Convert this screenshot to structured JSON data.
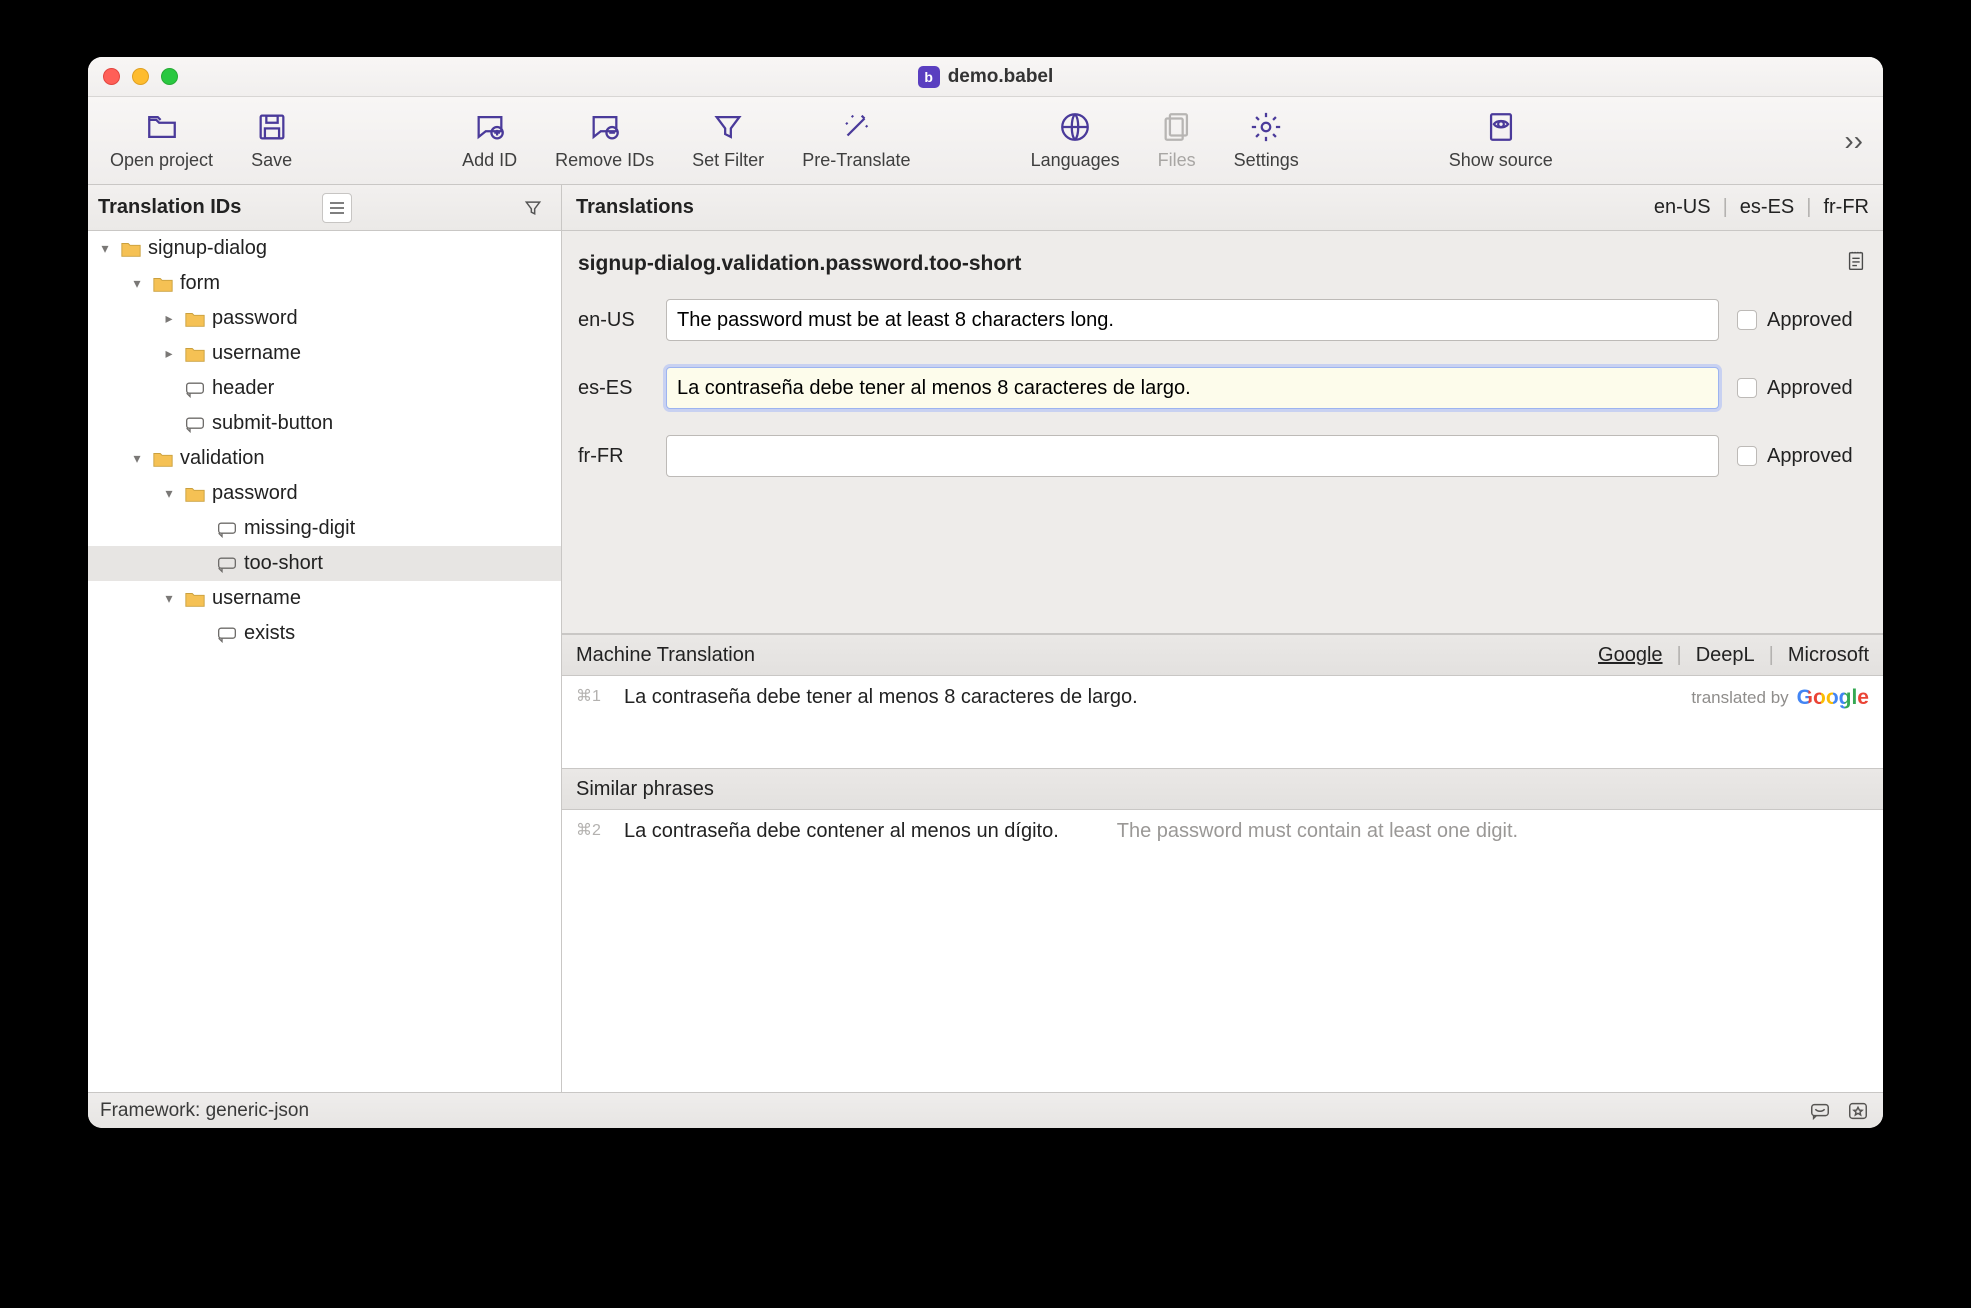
{
  "window": {
    "title": "demo.babel"
  },
  "toolbar": {
    "open": "Open project",
    "save": "Save",
    "addid": "Add ID",
    "remove": "Remove IDs",
    "filter": "Set Filter",
    "pretranslate": "Pre-Translate",
    "languages": "Languages",
    "files": "Files",
    "settings": "Settings",
    "showsource": "Show source"
  },
  "leftPanel": {
    "title": "Translation IDs"
  },
  "tree": {
    "n0": "signup-dialog",
    "n1": "form",
    "n2": "password",
    "n3": "username",
    "n4": "header",
    "n5": "submit-button",
    "n6": "validation",
    "n7": "password",
    "n8": "missing-digit",
    "n9": "too-short",
    "n10": "username",
    "n11": "exists"
  },
  "rightHeader": {
    "title": "Translations",
    "locales": {
      "a": "en-US",
      "b": "es-ES",
      "c": "fr-FR"
    }
  },
  "editor": {
    "idpath": "signup-dialog.validation.password.too-short",
    "rows": {
      "en": {
        "label": "en-US",
        "value": "The password must be at least 8 characters long.",
        "approved": "Approved"
      },
      "es": {
        "label": "es-ES",
        "value": "La contraseña debe tener al menos 8 caracteres de largo.",
        "approved": "Approved"
      },
      "fr": {
        "label": "fr-FR",
        "value": "",
        "approved": "Approved"
      }
    }
  },
  "mt": {
    "title": "Machine Translation",
    "providers": {
      "a": "Google",
      "b": "DeepL",
      "c": "Microsoft"
    },
    "shortcut": "⌘1",
    "suggestion": "La contraseña debe tener al menos 8 caracteres de largo.",
    "translated_by": "translated by",
    "brand": "Google"
  },
  "sp": {
    "title": "Similar phrases",
    "shortcut": "⌘2",
    "target": "La contraseña debe contener al menos un dígito.",
    "source": "The password must contain at least one digit."
  },
  "status": {
    "framework": "Framework: generic-json"
  }
}
